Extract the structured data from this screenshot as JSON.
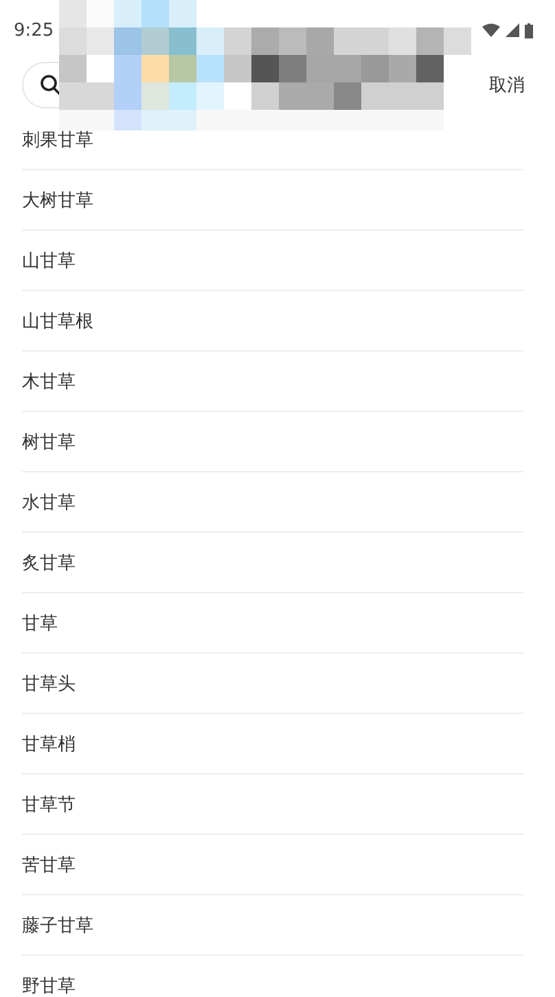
{
  "status_bar": {
    "time": "9:25"
  },
  "search": {
    "cancel": "取消"
  },
  "results": [
    {
      "name": "刺果甘草"
    },
    {
      "name": "大树甘草"
    },
    {
      "name": "山甘草"
    },
    {
      "name": "山甘草根"
    },
    {
      "name": "木甘草"
    },
    {
      "name": "树甘草"
    },
    {
      "name": "水甘草"
    },
    {
      "name": "炙甘草"
    },
    {
      "name": "甘草"
    },
    {
      "name": "甘草头"
    },
    {
      "name": "甘草梢"
    },
    {
      "name": "甘草节"
    },
    {
      "name": "苦甘草"
    },
    {
      "name": "藤子甘草"
    },
    {
      "name": "野甘草"
    }
  ]
}
